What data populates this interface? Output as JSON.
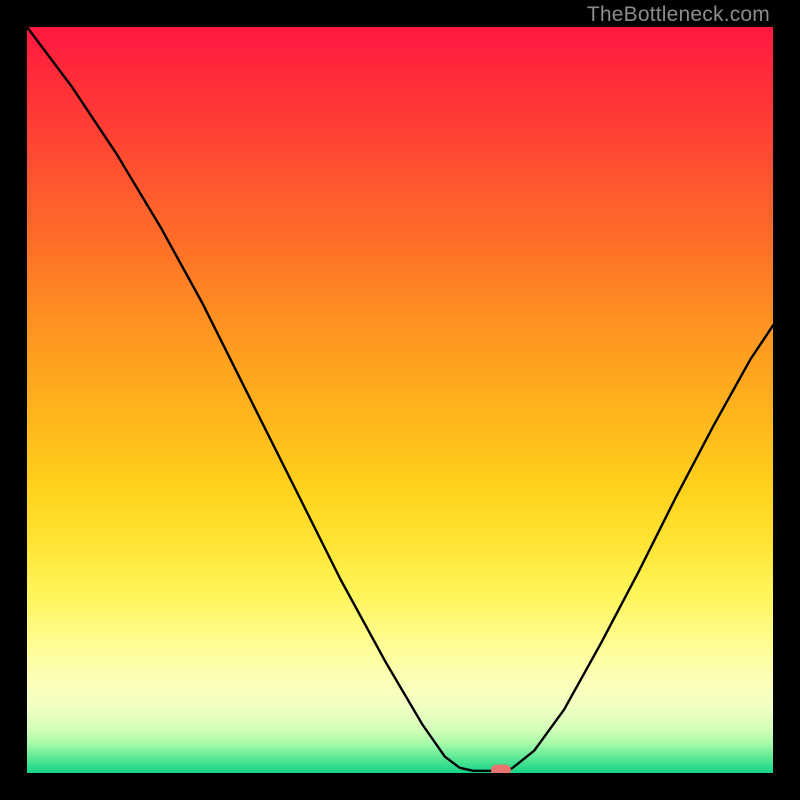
{
  "watermark": "TheBottleneck.com",
  "chart_data": {
    "type": "line",
    "title": "",
    "xlabel": "",
    "ylabel": "",
    "xlim": [
      0,
      1
    ],
    "ylim": [
      0,
      1
    ],
    "curve_points": [
      [
        0.0,
        1.0
      ],
      [
        0.06,
        0.92
      ],
      [
        0.12,
        0.83
      ],
      [
        0.18,
        0.73
      ],
      [
        0.235,
        0.63
      ],
      [
        0.3,
        0.5
      ],
      [
        0.36,
        0.38
      ],
      [
        0.42,
        0.26
      ],
      [
        0.48,
        0.15
      ],
      [
        0.53,
        0.065
      ],
      [
        0.56,
        0.022
      ],
      [
        0.58,
        0.007
      ],
      [
        0.598,
        0.003
      ],
      [
        0.63,
        0.003
      ],
      [
        0.65,
        0.006
      ],
      [
        0.68,
        0.03
      ],
      [
        0.72,
        0.085
      ],
      [
        0.77,
        0.175
      ],
      [
        0.82,
        0.27
      ],
      [
        0.87,
        0.37
      ],
      [
        0.92,
        0.465
      ],
      [
        0.97,
        0.555
      ],
      [
        1.0,
        0.6
      ]
    ],
    "gradient_stops": [
      {
        "pos": 0.0,
        "color": "#ff1740"
      },
      {
        "pos": 1.0,
        "color": "#14d487"
      }
    ],
    "marker": {
      "x": 0.635,
      "y": 0.004,
      "color": "#e7746f"
    }
  }
}
